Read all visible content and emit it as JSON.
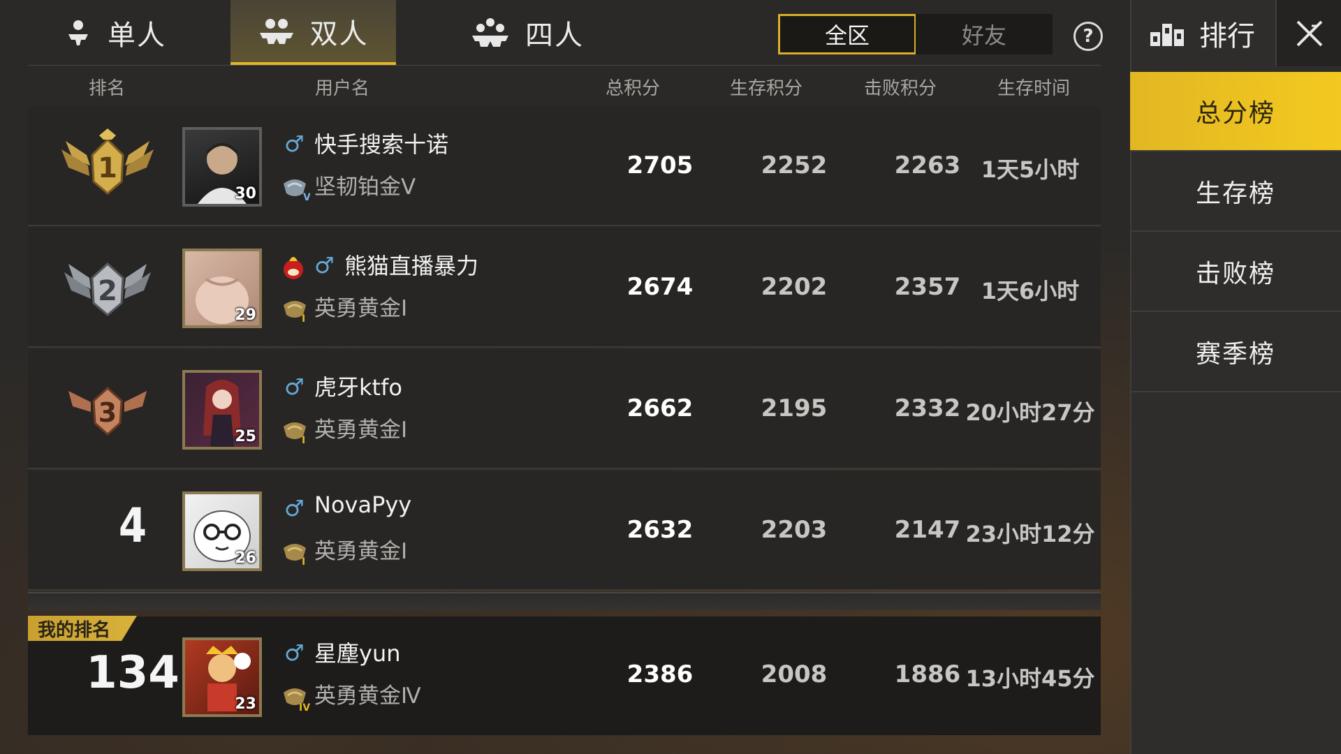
{
  "modes": [
    {
      "label": "单人",
      "icon": "solo-player-icon",
      "active": false
    },
    {
      "label": "双人",
      "icon": "duo-players-icon",
      "active": true
    },
    {
      "label": "四人",
      "icon": "squad-players-icon",
      "active": false
    }
  ],
  "region": {
    "all_label": "全区",
    "friends_label": "好友",
    "selected": "全区"
  },
  "help_label": "?",
  "columns": {
    "rank": "排名",
    "username": "用户名",
    "total": "总积分",
    "survival": "生存积分",
    "defeat": "击败积分",
    "survival_time": "生存时间"
  },
  "rows": [
    {
      "rank": "1",
      "rank_badge": "gold-wings-badge-icon",
      "level": "30",
      "gender": "♂",
      "name": "快手搜索十诺",
      "tier": "坚韧铂金Ⅴ",
      "total": "2705",
      "survival": "2252",
      "defeat": "2263",
      "time": "1天5小时"
    },
    {
      "rank": "2",
      "rank_badge": "silver-wings-badge-icon",
      "level": "29",
      "gender": "♂",
      "name": "熊猫直播暴力",
      "tier": "英勇黄金Ⅰ",
      "total": "2674",
      "survival": "2202",
      "defeat": "2357",
      "time": "1天6小时"
    },
    {
      "rank": "3",
      "rank_badge": "bronze-wings-badge-icon",
      "level": "25",
      "gender": "♂",
      "name": "虎牙ktfo",
      "tier": "英勇黄金Ⅰ",
      "total": "2662",
      "survival": "2195",
      "defeat": "2332",
      "time": "20小时27分"
    },
    {
      "rank": "4",
      "level": "26",
      "gender": "♂",
      "name": "NovaPyy",
      "tier": "英勇黄金Ⅰ",
      "total": "2632",
      "survival": "2203",
      "defeat": "2147",
      "time": "23小时12分"
    }
  ],
  "my_rank": {
    "label": "我的排名",
    "rank": "134",
    "level": "23",
    "gender": "♂",
    "name": "星塵yun",
    "tier": "英勇黄金Ⅳ",
    "total": "2386",
    "survival": "2008",
    "defeat": "1886",
    "time": "13小时45分"
  },
  "panel": {
    "title": "排行",
    "title_icon": "podium-icon",
    "close_icon": "close-icon",
    "boards": [
      {
        "label": "总分榜",
        "active": true
      },
      {
        "label": "生存榜",
        "active": false
      },
      {
        "label": "击败榜",
        "active": false
      },
      {
        "label": "赛季榜",
        "active": false
      }
    ]
  },
  "colors": {
    "accent": "#e2b722",
    "background": "#2b2927",
    "gender": "#64a8d8"
  }
}
